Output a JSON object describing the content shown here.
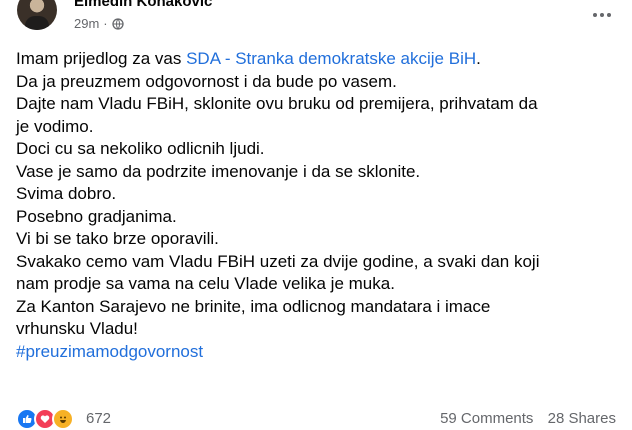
{
  "header": {
    "author": "Elmedin Konaković",
    "time": "29m",
    "separator": "·",
    "audience_icon": "globe-icon",
    "more_icon": "more-options-icon"
  },
  "post": {
    "lines": [
      {
        "text": "Imam prijedlog za vas ",
        "link": "SDA - Stranka demokratske akcije BiH",
        "suffix": "."
      },
      {
        "text": "Da ja preuzmem odgovornost i da bude po vasem."
      },
      {
        "text": "Dajte nam Vladu FBiH, sklonite ovu bruku od premijera, prihvatam da"
      },
      {
        "text": "je vodimo."
      },
      {
        "text": "Doci cu sa nekoliko odlicnih ljudi."
      },
      {
        "text": "Vase je samo da podrzite imenovanje i da se sklonite."
      },
      {
        "text": "Svima dobro."
      },
      {
        "text": "Posebno gradjanima."
      },
      {
        "text": "Vi bi se tako brze oporavili."
      },
      {
        "text": "Svakako cemo vam Vladu FBiH uzeti za dvije godine, a svaki dan koji"
      },
      {
        "text": "nam prodje sa vama na celu Vlade velika je muka."
      },
      {
        "text": "Za Kanton Sarajevo ne brinite, ima odlicnog mandatara i imace"
      },
      {
        "text": "vrhunsku Vladu!"
      }
    ],
    "hashtag": "#preuzimamodgovornost"
  },
  "footer": {
    "reactions": [
      "like-icon",
      "love-icon",
      "haha-icon"
    ],
    "reaction_count": "672",
    "comments": "59 Comments",
    "shares": "28 Shares"
  },
  "colors": {
    "link": "#216fdb",
    "secondary_text": "#65676b",
    "like": "#1877f2",
    "love": "#f33e58",
    "haha": "#f7b125"
  }
}
